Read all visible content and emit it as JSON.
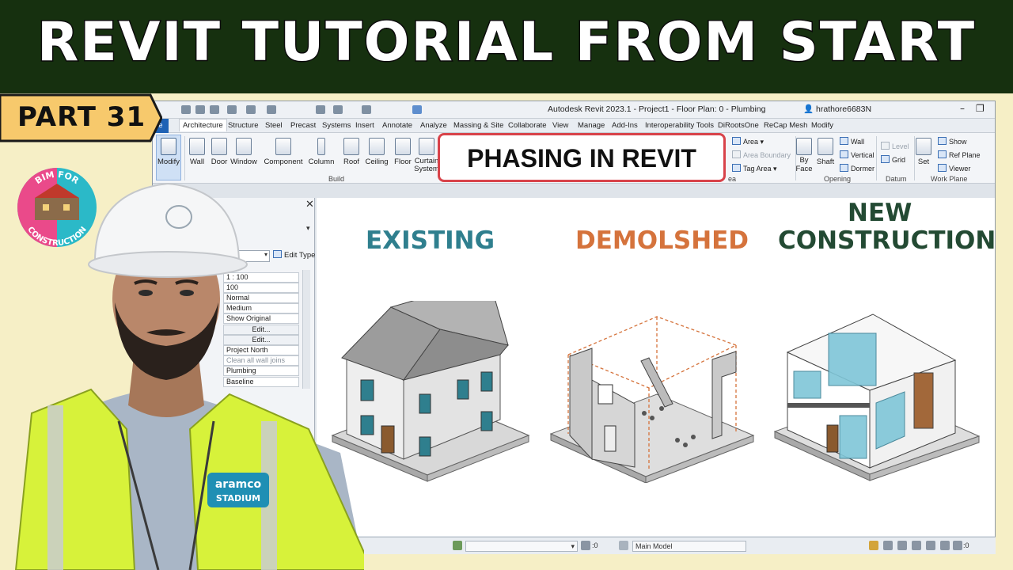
{
  "banner": {
    "title": "REVIT TUTORIAL FROM START"
  },
  "badge": {
    "part": "PART 31"
  },
  "logo": {
    "top_text": "BIM FOR",
    "bottom_text": "CONSTRUCTION"
  },
  "person": {
    "vest_line1": "aramco",
    "vest_line2": "STADIUM"
  },
  "window": {
    "title": "Autodesk Revit 2023.1 - Project1 - Floor Plan: 0 - Plumbing",
    "user": "hrathore6683N",
    "controls": [
      "–",
      "❐"
    ]
  },
  "tabs": [
    "ile",
    "Architecture",
    "Structure",
    "Steel",
    "Precast",
    "Systems",
    "Insert",
    "Annotate",
    "Analyze",
    "Massing & Site",
    "Collaborate",
    "View",
    "Manage",
    "Add-Ins",
    "Interoperability Tools",
    "DiRootsOne",
    "ReCap Mesh",
    "Modify"
  ],
  "ribbon": {
    "modify": "Modify",
    "build_buttons": [
      "Wall",
      "Door",
      "Window",
      "Component",
      "Column",
      "Roof",
      "Ceiling",
      "Floor",
      "Curtain System"
    ],
    "build_label": "Build",
    "area": {
      "area": "Area",
      "area_boundary": "Area  Boundary",
      "tag_area": "Tag  Area",
      "panel_label": "ea"
    },
    "opening": {
      "by_face_1": "By",
      "by_face_2": "Face",
      "shaft": "Shaft",
      "wall": "Wall",
      "vertical": "Vertical",
      "dormer": "Dormer",
      "label": "Opening"
    },
    "datum": {
      "level": "Level",
      "grid": "Grid",
      "label": "Datum"
    },
    "work_plane": {
      "set": "Set",
      "show": "Show",
      "ref_plane": "Ref  Plane",
      "viewer": "Viewer",
      "label": "Work Plane"
    }
  },
  "overlay": {
    "title": "PHASING IN REVIT"
  },
  "properties": {
    "edit_type": "Edit Type",
    "rows": [
      "1 : 100",
      "100",
      "Normal",
      "Medium",
      "Show Original",
      "Edit...",
      "Edit...",
      "Project North",
      "Clean all wall joins",
      "Plumbing",
      "Baseline"
    ]
  },
  "phases": [
    {
      "label": "EXISTING",
      "color": "#2f7f8e"
    },
    {
      "label": "DEMOLSHED",
      "color": "#d5733c"
    },
    {
      "label_line1": "NEW",
      "label_line2": "CONSTRUCTION",
      "color": "#234a33"
    }
  ],
  "status": {
    "worksets": ":0",
    "model": "Main Model",
    "filter": ":0"
  }
}
